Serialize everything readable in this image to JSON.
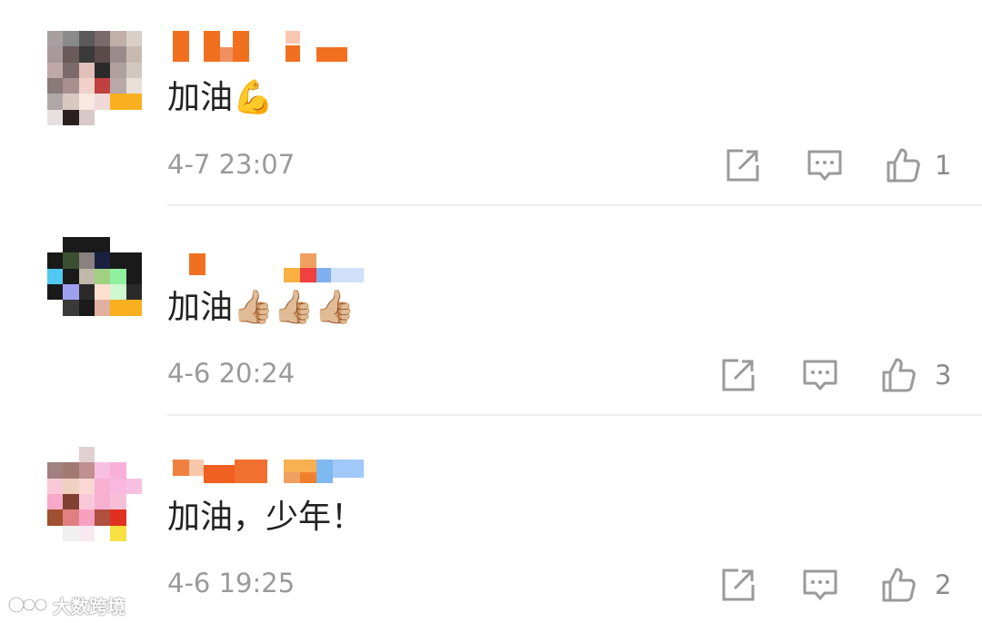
{
  "comments": [
    {
      "text": "加油💪",
      "time": "4-7 23:07",
      "likes": "1",
      "avatar_pixels": [
        "#a8a0a0",
        "#8a8a8a",
        "#5a5a5a",
        "#7a6a6a",
        "#c0b0a8",
        "#d8d0c8",
        "#a89a9a",
        "#6a5a5a",
        "#3a3a3a",
        "#5a4a4a",
        "#9a8a8a",
        "#c8bab0",
        "#c0a8a8",
        "#7a6a6a",
        "#e0c0b8",
        "#2a2a2a",
        "#b0a0a0",
        "#d0c8c0",
        "#8a7a7a",
        "#a89090",
        "#f0d0c8",
        "#c04040",
        "#b8a8a8",
        "#e8e0d8",
        "#b0a8a8",
        "#d8c8c0",
        "#f8e8e0",
        "#f0d8d8",
        "#f8b020",
        "#f8b020",
        "#e8e0e0",
        "#2a2020",
        "#d8c8c8",
        "#ffffff",
        "#ffffff",
        "#ffffff"
      ],
      "name_blocks": [
        {
          "color": "#f07020"
        },
        {
          "color": "#f07020"
        },
        {
          "color": "#f09060"
        },
        {
          "color": "#f07020"
        },
        {
          "color": "#f8c8b0"
        },
        {
          "color": "#f07020"
        },
        {
          "color": "#f07020"
        }
      ]
    },
    {
      "text": "加油👍🏼👍🏼👍🏼",
      "time": "4-6 20:24",
      "likes": "3",
      "avatar_pixels": [
        "#ffffff",
        "#1a1a1a",
        "#1a1a1a",
        "#1a1a1a",
        "#ffffff",
        "#ffffff",
        "#1a1a1a",
        "#3a5030",
        "#8a8080",
        "#1a2040",
        "#1a1a1a",
        "#1a1a1a",
        "#50c8f0",
        "#1a1a1a",
        "#c0b8a8",
        "#a0d080",
        "#90f0a0",
        "#1a1a1a",
        "#1a1a1a",
        "#a0a0f0",
        "#2a2a2a",
        "#ffe0d0",
        "#d0f8d0",
        "#2a2a2a",
        "#ffffff",
        "#3a3a3a",
        "#1a1a1a",
        "#e0b0a0",
        "#f8b020",
        "#f8b020",
        "#ffffff",
        "#ffffff",
        "#ffffff",
        "#ffffff",
        "#ffffff",
        "#ffffff"
      ],
      "name_blocks": [
        {
          "color": "#f07020"
        },
        {
          "color": "#f8b040"
        },
        {
          "color": "#f04040"
        },
        {
          "color": "#80b0f0"
        },
        {
          "color": "#d0e0f8"
        },
        {
          "color": "#f0a060"
        }
      ]
    },
    {
      "text": "加油，少年！",
      "time": "4-6 19:25",
      "likes": "2",
      "avatar_pixels": [
        "#ffffff",
        "#ffffff",
        "#e0d0d0",
        "#ffffff",
        "#ffffff",
        "#ffffff",
        "#a08080",
        "#a07a70",
        "#c09090",
        "#f8c0e0",
        "#f8b0d8",
        "#ffffff",
        "#f8c8d8",
        "#f0d0c0",
        "#f8d8d0",
        "#f8b0d0",
        "#f8b8e0",
        "#f8c0e0",
        "#f8a8c8",
        "#804030",
        "#f8c8d8",
        "#f8b0d0",
        "#f8c0d8",
        "#ffffff",
        "#a05030",
        "#e08080",
        "#f8a0c0",
        "#b05040",
        "#e03020",
        "#ffffff",
        "#ffffff",
        "#f0f0f0",
        "#f8e8f0",
        "#ffffff",
        "#f8e040",
        "#ffffff"
      ],
      "name_blocks": [
        {
          "color": "#f08040"
        },
        {
          "color": "#f8c8a8"
        },
        {
          "color": "#f06020"
        },
        {
          "color": "#f07030"
        },
        {
          "color": "#f8b050"
        },
        {
          "color": "#f0a060"
        },
        {
          "color": "#f08030"
        },
        {
          "color": "#80b8f0"
        },
        {
          "color": "#a0c8f8"
        }
      ]
    }
  ],
  "actions": {
    "share_icon": "share-icon",
    "reply_icon": "comment-icon",
    "like_icon": "thumbs-up-icon"
  },
  "colors": {
    "text": "#222222",
    "muted": "#9a9a9a",
    "icon": "#9a9a9a",
    "divider": "#ededed"
  },
  "watermark": {
    "label": "大数跨境",
    "logo_icon": "watermark-logo-icon"
  }
}
